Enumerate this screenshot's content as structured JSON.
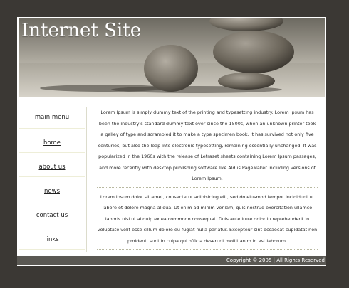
{
  "header": {
    "site_title": "Internet Site"
  },
  "sidebar": {
    "heading": "main menu",
    "items": [
      {
        "label": "home"
      },
      {
        "label": "about us"
      },
      {
        "label": "news"
      },
      {
        "label": "contact us"
      },
      {
        "label": "links"
      }
    ]
  },
  "content": {
    "paragraph_1": "Lorem Ipsum is simply dummy text of the printing and typesetting industry. Lorem Ipsum has been the industry's standard dummy text ever since the 1500s, when an unknown printer took a galley of type and scrambled it to make a type specimen book. It has survived not only five centuries, but also the leap into electronic typesetting, remaining essentially unchanged. It was popularized in the 1960s with the release of Letraset sheets containing Lorem Ipsum passages, and more recently with desktop publishing software like Aldus PageMaker including versions of Lorem Ipsum.",
    "paragraph_2": "Lorem ipsum dolor sit amet, consectetur adipisicing elit, sed do eiusmod tempor incididunt ut labore et dolore magna aliqua. Ut enim ad minim veniam, quis nostrud exercitation ullamco laboris nisi ut aliquip ex ea commodo consequat. Duis aute irure dolor in reprehenderit in voluptate velit esse cillum dolore eu fugiat nulla pariatur. Excepteur sint occaecat cupidatat non proident, sunt in culpa qui officia deserunt mollit anim id est laborum."
  },
  "footer": {
    "copyright": "Copyright © 2005 | All Rights Reserved"
  },
  "colors": {
    "page_background": "#3b3834",
    "footer_background": "#5a5853",
    "divider": "#eeeed8"
  }
}
